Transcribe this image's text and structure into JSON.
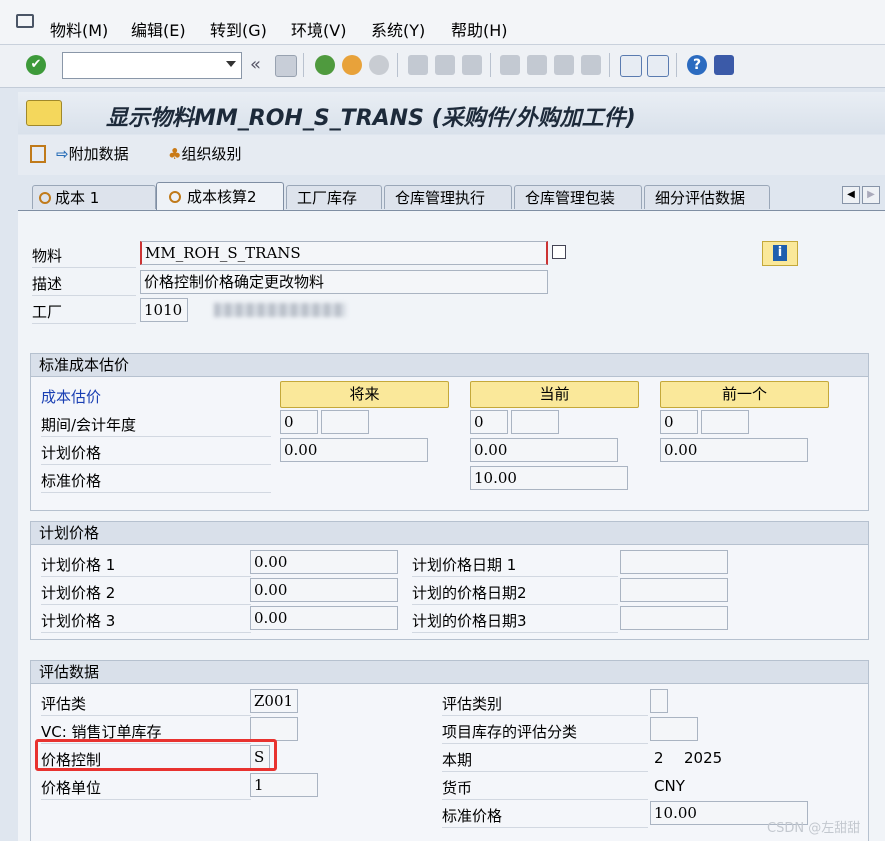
{
  "menu": {
    "items": [
      "物料(M)",
      "编辑(E)",
      "转到(G)",
      "环境(V)",
      "系统(Y)",
      "帮助(H)"
    ]
  },
  "toolbar": {
    "command_value": ""
  },
  "title": {
    "text": "显示物料MM_ROH_S_TRANS (采购件/外购加工件)"
  },
  "app_toolbar": {
    "additional_data": "附加数据",
    "org_levels": "组织级别"
  },
  "tabs": [
    "成本 1",
    "成本核算2",
    "工厂库存",
    "仓库管理执行",
    "仓库管理包装",
    "细分评估数据"
  ],
  "header_fields": {
    "material_label": "物料",
    "material_value": "MM_ROH_S_TRANS",
    "description_label": "描述",
    "description_value": "价格控制价格确定更改物料",
    "plant_label": "工厂",
    "plant_value": "1010"
  },
  "standard_cost": {
    "title": "标准成本估价",
    "cost_estimate_label": "成本估价",
    "buttons": [
      "将来",
      "当前",
      "前一个"
    ],
    "period_label": "期间/会计年度",
    "periods": [
      "0",
      "0",
      "0"
    ],
    "planned_price_label": "计划价格",
    "planned_prices": [
      "0.00",
      "0.00",
      "0.00"
    ],
    "standard_price_label": "标准价格",
    "standard_price_current": "10.00"
  },
  "planned_price": {
    "title": "计划价格",
    "rows": [
      {
        "label": "计划价格 1",
        "value": "0.00",
        "date_label": "计划价格日期 1"
      },
      {
        "label": "计划价格 2",
        "value": "0.00",
        "date_label": "计划的价格日期2"
      },
      {
        "label": "计划价格 3",
        "value": "0.00",
        "date_label": "计划的价格日期3"
      }
    ]
  },
  "valuation": {
    "title": "评估数据",
    "valuation_class_label": "评估类",
    "valuation_class_value": "Z001",
    "vc_label": "VC: 销售订单库存",
    "price_control_label": "价格控制",
    "price_control_value": "S",
    "price_unit_label": "价格单位",
    "price_unit_value": "1",
    "valuation_category_label": "评估类别",
    "project_stock_label": "项目库存的评估分类",
    "current_period_label": "本期",
    "current_period_value": "2",
    "current_year_value": "2025",
    "currency_label": "货币",
    "currency_value": "CNY",
    "std_price_label": "标准价格",
    "std_price_value": "10.00"
  },
  "watermark": "CSDN @左甜甜",
  "colors": {
    "highlight_box": "#e8322f",
    "button_yellow": "#fae89a",
    "link_blue": "#1a3fb3"
  }
}
